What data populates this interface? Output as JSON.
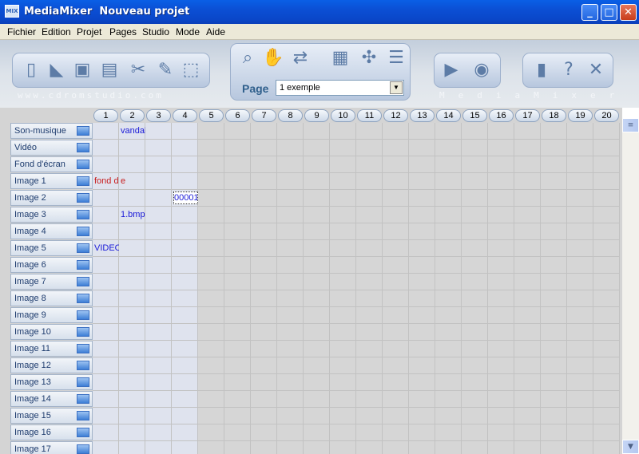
{
  "window": {
    "icon_text": "MIX",
    "title": "MediaMixer  Nouveau projet",
    "minimize": "_",
    "maximize": "□",
    "close": "✕"
  },
  "menu": [
    {
      "label": "Fichier"
    },
    {
      "label": "Edition"
    },
    {
      "label": "Projet"
    },
    {
      "label": "Pages"
    },
    {
      "label": "Studio"
    },
    {
      "label": "Mode"
    },
    {
      "label": "Aide"
    }
  ],
  "toolbar": {
    "watermark_left": "www.cdromstudio.com",
    "watermark_right": "MediaMixer",
    "page_label": "Page",
    "page_select_value": "1  exemple",
    "page_select_arrow": "▼"
  },
  "icons": {
    "left": [
      "new-file-icon",
      "open-folder-icon",
      "save-disk-icon",
      "document-icon",
      "cut-scissors-icon",
      "edit-icon",
      "package-box-icon"
    ],
    "mid": [
      "search-magnifier-icon",
      "hand-icon",
      "image-swap-icon"
    ],
    "grid": [
      "grid-table-icon",
      "puzzle-icon",
      "layout-icon"
    ],
    "right": [
      "play-icon",
      "media-disc-icon",
      "book-icon",
      "help-icon",
      "close-tools-icon"
    ]
  },
  "columns": [
    "1",
    "2",
    "3",
    "4",
    "5",
    "6",
    "7",
    "8",
    "9",
    "10",
    "11",
    "12",
    "13",
    "14",
    "15",
    "16",
    "17",
    "18",
    "19",
    "20"
  ],
  "rows": [
    {
      "label": "Son-musique",
      "icon": "music-note-icon"
    },
    {
      "label": "Vidéo",
      "icon": "film-icon"
    },
    {
      "label": "Fond d'écran",
      "icon": "wallpaper-icon"
    },
    {
      "label": "Image 1",
      "icon": "image-icon"
    },
    {
      "label": "Image 2",
      "icon": "image-icon"
    },
    {
      "label": "Image 3",
      "icon": "image-icon"
    },
    {
      "label": "Image 4",
      "icon": "image-icon"
    },
    {
      "label": "Image 5",
      "icon": "image-icon"
    },
    {
      "label": "Image 6",
      "icon": "image-icon"
    },
    {
      "label": "Image 7",
      "icon": "image-icon"
    },
    {
      "label": "Image 8",
      "icon": "image-icon"
    },
    {
      "label": "Image 9",
      "icon": "image-icon"
    },
    {
      "label": "Image 10",
      "icon": "image-icon"
    },
    {
      "label": "Image 11",
      "icon": "image-icon"
    },
    {
      "label": "Image 12",
      "icon": "image-icon"
    },
    {
      "label": "Image 13",
      "icon": "image-icon"
    },
    {
      "label": "Image 14",
      "icon": "image-icon"
    },
    {
      "label": "Image 15",
      "icon": "image-icon"
    },
    {
      "label": "Image 16",
      "icon": "image-icon"
    },
    {
      "label": "Image 17",
      "icon": "image-icon"
    }
  ],
  "cells": [
    {
      "row": 0,
      "col": 1,
      "text": "vandal",
      "color": "#1a1ad8"
    },
    {
      "row": 3,
      "col": 0,
      "text": "fond d",
      "color": "#c81e1e"
    },
    {
      "row": 3,
      "col": 1,
      "text": "e",
      "color": "#c81e1e"
    },
    {
      "row": 4,
      "col": 3,
      "text": "00001",
      "color": "#1a1ad8",
      "selected": true
    },
    {
      "row": 5,
      "col": 1,
      "text": "1.bmp",
      "color": "#1a1ad8"
    },
    {
      "row": 7,
      "col": 0,
      "text": "VIDEO",
      "color": "#1a1ad8"
    }
  ],
  "colors": {
    "titlebar": "#0b4fd4",
    "grid_bg": "#d4d4d4",
    "light_col": "#dfe3ee",
    "text_blue": "#1a1ad8",
    "text_red": "#c81e1e"
  },
  "scrollbar": {
    "up": "▲",
    "down": "▼"
  }
}
